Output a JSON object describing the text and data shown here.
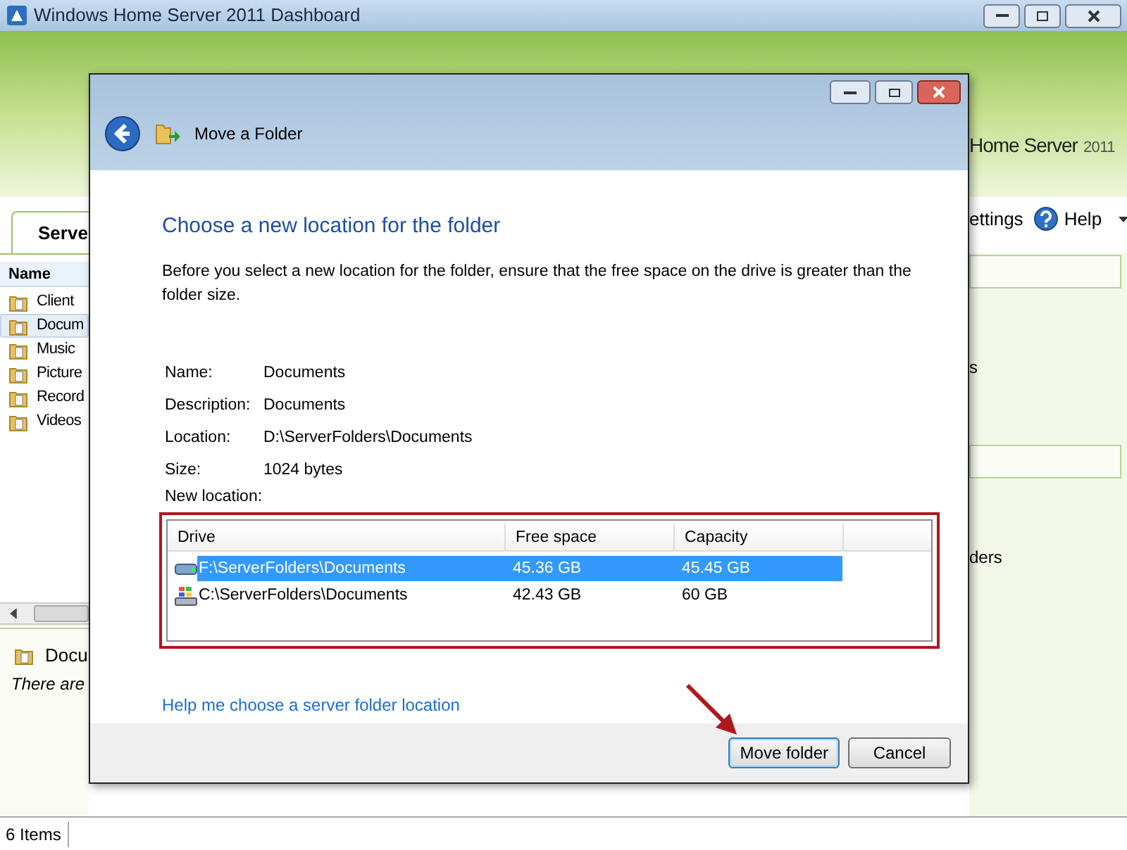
{
  "window": {
    "title": "Windows Home Server 2011 Dashboard"
  },
  "banner": {
    "brand": "Home Server",
    "year": "2011"
  },
  "tabs": [
    {
      "label": "Serve",
      "selected": true
    }
  ],
  "toolbar": [
    {
      "label": "ettings",
      "kind": "link"
    },
    {
      "label": "Help",
      "kind": "menu"
    }
  ],
  "folder_list": {
    "column": "Name",
    "items": [
      {
        "label": "Client",
        "selected": false
      },
      {
        "label": "Docum",
        "selected": true
      },
      {
        "label": "Music",
        "selected": false
      },
      {
        "label": "Picture",
        "selected": false
      },
      {
        "label": "Record",
        "selected": false
      },
      {
        "label": "Videos",
        "selected": false
      }
    ]
  },
  "details": {
    "title": "Docu",
    "note": "There are"
  },
  "right_panel": {
    "texts": [
      "s",
      "ders"
    ]
  },
  "status_bar": {
    "count": "6 Items"
  },
  "dialog": {
    "title": "Move a Folder",
    "heading": "Choose a new location for the folder",
    "description": "Before you select a new location for the folder, ensure that the free space on the drive is greater than the folder size.",
    "properties": [
      {
        "label": "Name:",
        "value": "Documents"
      },
      {
        "label": "Description:",
        "value": "Documents"
      },
      {
        "label": "Location:",
        "value": "D:\\ServerFolders\\Documents"
      },
      {
        "label": "Size:",
        "value": "1024 bytes"
      }
    ],
    "new_location_label": "New location:",
    "drives": {
      "columns": [
        "Drive",
        "Free space",
        "Capacity"
      ],
      "rows": [
        {
          "kind": "usb",
          "drive": "F:\\ServerFolders\\Documents",
          "free": "45.36 GB",
          "capacity": "45.45 GB",
          "selected": true
        },
        {
          "kind": "system",
          "drive": "C:\\ServerFolders\\Documents",
          "free": "42.43 GB",
          "capacity": "60 GB",
          "selected": false
        }
      ]
    },
    "help_link": "Help me choose a server folder location",
    "buttons": [
      {
        "label": "Move folder",
        "default": true
      },
      {
        "label": "Cancel",
        "default": false
      }
    ]
  }
}
